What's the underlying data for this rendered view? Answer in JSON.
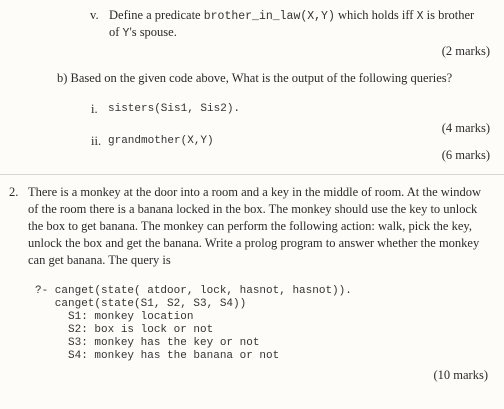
{
  "q_v": {
    "label": "v.",
    "text_before": "Define a predicate ",
    "predicate": "brother_in_law(X,Y)",
    "text_mid": " which holds iff ",
    "var_x": "X",
    "text_after": " is brother",
    "line2_before": "of ",
    "var_y": "Y",
    "line2_after": "'s spouse.",
    "marks": "(2 marks)"
  },
  "part_b": {
    "label": "b)",
    "text": "Based on the given code above, What is the output of the following queries?",
    "items": [
      {
        "label": "i.",
        "query": "sisters(Sis1, Sis2)."
      },
      {
        "label": "ii.",
        "query": "grandmother(X,Y)"
      }
    ],
    "marks": [
      "(4 marks)",
      "(6  marks)"
    ]
  },
  "q2": {
    "number": "2.",
    "lines": [
      "There is a monkey at the door into a room and a key in the middle of room. At the window",
      "of the room there is a banana locked in the box. The monkey should use the key to unlock",
      "the box to get banana. The monkey can perform the following action: walk, pick the key,",
      "unlock the box and get the banana. Write a prolog program to answer whether the monkey",
      "can get banana. The query is"
    ],
    "code": [
      "?- canget(state( atdoor, lock, hasnot, hasnot)).",
      "   canget(state(S1, S2, S3, S4))",
      "     S1: monkey location",
      "     S2: box is lock or not",
      "     S3: monkey has the key or not",
      "     S4: monkey has the banana or not"
    ],
    "marks": "(10 marks)"
  }
}
